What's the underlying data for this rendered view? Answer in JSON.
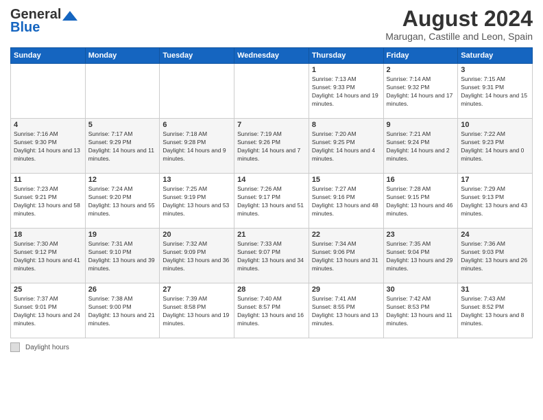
{
  "header": {
    "logo_general": "General",
    "logo_blue": "Blue",
    "main_title": "August 2024",
    "subtitle": "Marugan, Castille and Leon, Spain"
  },
  "days": [
    "Sunday",
    "Monday",
    "Tuesday",
    "Wednesday",
    "Thursday",
    "Friday",
    "Saturday"
  ],
  "footer_label": "Daylight hours",
  "weeks": [
    [
      {
        "date": "",
        "info": ""
      },
      {
        "date": "",
        "info": ""
      },
      {
        "date": "",
        "info": ""
      },
      {
        "date": "",
        "info": ""
      },
      {
        "date": "1",
        "info": "Sunrise: 7:13 AM\nSunset: 9:33 PM\nDaylight: 14 hours and 19 minutes."
      },
      {
        "date": "2",
        "info": "Sunrise: 7:14 AM\nSunset: 9:32 PM\nDaylight: 14 hours and 17 minutes."
      },
      {
        "date": "3",
        "info": "Sunrise: 7:15 AM\nSunset: 9:31 PM\nDaylight: 14 hours and 15 minutes."
      }
    ],
    [
      {
        "date": "4",
        "info": "Sunrise: 7:16 AM\nSunset: 9:30 PM\nDaylight: 14 hours and 13 minutes."
      },
      {
        "date": "5",
        "info": "Sunrise: 7:17 AM\nSunset: 9:29 PM\nDaylight: 14 hours and 11 minutes."
      },
      {
        "date": "6",
        "info": "Sunrise: 7:18 AM\nSunset: 9:28 PM\nDaylight: 14 hours and 9 minutes."
      },
      {
        "date": "7",
        "info": "Sunrise: 7:19 AM\nSunset: 9:26 PM\nDaylight: 14 hours and 7 minutes."
      },
      {
        "date": "8",
        "info": "Sunrise: 7:20 AM\nSunset: 9:25 PM\nDaylight: 14 hours and 4 minutes."
      },
      {
        "date": "9",
        "info": "Sunrise: 7:21 AM\nSunset: 9:24 PM\nDaylight: 14 hours and 2 minutes."
      },
      {
        "date": "10",
        "info": "Sunrise: 7:22 AM\nSunset: 9:23 PM\nDaylight: 14 hours and 0 minutes."
      }
    ],
    [
      {
        "date": "11",
        "info": "Sunrise: 7:23 AM\nSunset: 9:21 PM\nDaylight: 13 hours and 58 minutes."
      },
      {
        "date": "12",
        "info": "Sunrise: 7:24 AM\nSunset: 9:20 PM\nDaylight: 13 hours and 55 minutes."
      },
      {
        "date": "13",
        "info": "Sunrise: 7:25 AM\nSunset: 9:19 PM\nDaylight: 13 hours and 53 minutes."
      },
      {
        "date": "14",
        "info": "Sunrise: 7:26 AM\nSunset: 9:17 PM\nDaylight: 13 hours and 51 minutes."
      },
      {
        "date": "15",
        "info": "Sunrise: 7:27 AM\nSunset: 9:16 PM\nDaylight: 13 hours and 48 minutes."
      },
      {
        "date": "16",
        "info": "Sunrise: 7:28 AM\nSunset: 9:15 PM\nDaylight: 13 hours and 46 minutes."
      },
      {
        "date": "17",
        "info": "Sunrise: 7:29 AM\nSunset: 9:13 PM\nDaylight: 13 hours and 43 minutes."
      }
    ],
    [
      {
        "date": "18",
        "info": "Sunrise: 7:30 AM\nSunset: 9:12 PM\nDaylight: 13 hours and 41 minutes."
      },
      {
        "date": "19",
        "info": "Sunrise: 7:31 AM\nSunset: 9:10 PM\nDaylight: 13 hours and 39 minutes."
      },
      {
        "date": "20",
        "info": "Sunrise: 7:32 AM\nSunset: 9:09 PM\nDaylight: 13 hours and 36 minutes."
      },
      {
        "date": "21",
        "info": "Sunrise: 7:33 AM\nSunset: 9:07 PM\nDaylight: 13 hours and 34 minutes."
      },
      {
        "date": "22",
        "info": "Sunrise: 7:34 AM\nSunset: 9:06 PM\nDaylight: 13 hours and 31 minutes."
      },
      {
        "date": "23",
        "info": "Sunrise: 7:35 AM\nSunset: 9:04 PM\nDaylight: 13 hours and 29 minutes."
      },
      {
        "date": "24",
        "info": "Sunrise: 7:36 AM\nSunset: 9:03 PM\nDaylight: 13 hours and 26 minutes."
      }
    ],
    [
      {
        "date": "25",
        "info": "Sunrise: 7:37 AM\nSunset: 9:01 PM\nDaylight: 13 hours and 24 minutes."
      },
      {
        "date": "26",
        "info": "Sunrise: 7:38 AM\nSunset: 9:00 PM\nDaylight: 13 hours and 21 minutes."
      },
      {
        "date": "27",
        "info": "Sunrise: 7:39 AM\nSunset: 8:58 PM\nDaylight: 13 hours and 19 minutes."
      },
      {
        "date": "28",
        "info": "Sunrise: 7:40 AM\nSunset: 8:57 PM\nDaylight: 13 hours and 16 minutes."
      },
      {
        "date": "29",
        "info": "Sunrise: 7:41 AM\nSunset: 8:55 PM\nDaylight: 13 hours and 13 minutes."
      },
      {
        "date": "30",
        "info": "Sunrise: 7:42 AM\nSunset: 8:53 PM\nDaylight: 13 hours and 11 minutes."
      },
      {
        "date": "31",
        "info": "Sunrise: 7:43 AM\nSunset: 8:52 PM\nDaylight: 13 hours and 8 minutes."
      }
    ]
  ]
}
